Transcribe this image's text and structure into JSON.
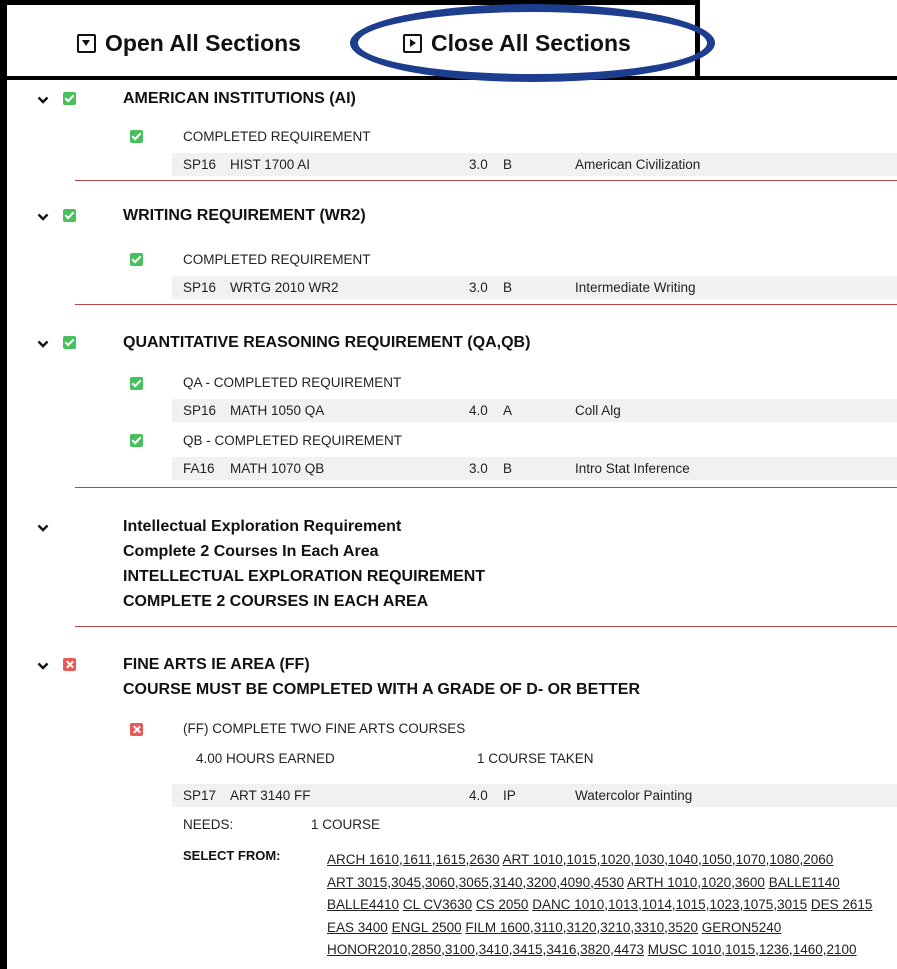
{
  "toolbar": {
    "open_label": "Open All Sections",
    "close_label": "Close All Sections",
    "highlight_color": "#1d3d8f"
  },
  "sections": [
    {
      "title": "AMERICAN INSTITUTIONS (AI)",
      "status": "complete",
      "requirements": [
        {
          "label": "COMPLETED REQUIREMENT",
          "courses": [
            {
              "term": "SP16",
              "course": "HIST 1700 AI",
              "credits": "3.0",
              "grade": "B",
              "title": "American Civilization"
            }
          ]
        }
      ]
    },
    {
      "title": "WRITING REQUIREMENT (WR2)",
      "status": "complete",
      "requirements": [
        {
          "label": "COMPLETED REQUIREMENT",
          "courses": [
            {
              "term": "SP16",
              "course": "WRTG 2010 WR2",
              "credits": "3.0",
              "grade": "B",
              "title": "Intermediate Writing"
            }
          ]
        }
      ]
    },
    {
      "title": "QUANTITATIVE REASONING REQUIREMENT (QA,QB)",
      "status": "complete",
      "requirements": [
        {
          "label": "QA - COMPLETED REQUIREMENT",
          "courses": [
            {
              "term": "SP16",
              "course": "MATH 1050 QA",
              "credits": "4.0",
              "grade": "A",
              "title": "Coll Alg"
            }
          ]
        },
        {
          "label": "QB - COMPLETED REQUIREMENT",
          "courses": [
            {
              "term": "FA16",
              "course": "MATH 1070 QB",
              "credits": "3.0",
              "grade": "B",
              "title": "Intro Stat Inference"
            }
          ]
        }
      ]
    },
    {
      "title_lines": [
        "Intellectual Exploration Requirement",
        "Complete 2 Courses In Each Area",
        "INTELLECTUAL EXPLORATION REQUIREMENT",
        "COMPLETE 2 COURSES IN EACH AREA"
      ]
    },
    {
      "title_lines": [
        "FINE ARTS IE AREA (FF)",
        "COURSE MUST BE COMPLETED WITH A GRADE OF D- OR BETTER"
      ],
      "status": "incomplete",
      "requirements": [
        {
          "label": "(FF) COMPLETE TWO FINE ARTS COURSES",
          "hours_earned": "4.00 HOURS EARNED",
          "courses_taken": "1 COURSE TAKEN",
          "courses": [
            {
              "term": "SP17",
              "course": "ART 3140 FF",
              "credits": "4.0",
              "grade": "IP",
              "title": "Watercolor Painting"
            }
          ],
          "needs_label": "NEEDS:",
          "needs_value": "1 COURSE",
          "select_from_label": "SELECT FROM:",
          "select_from": [
            "ARCH 1610",
            "1611",
            "1615",
            "2630",
            "ART 1010",
            "1015",
            "1020",
            "1030",
            "1040",
            "1050",
            "1070",
            "1080",
            "2060",
            "ART 3015",
            "3045",
            "3060",
            "3065",
            "3140",
            "3200",
            "4090",
            "4530",
            "ARTH 1010",
            "1020",
            "3600",
            "BALLE1140",
            "BALLE4410",
            "CL CV3630",
            "CS 2050",
            "DANC 1010",
            "1013",
            "1014",
            "1015",
            "1023",
            "1075",
            "3015",
            "DES 2615",
            "EAS 3400",
            "ENGL 2500",
            "FILM 1600",
            "3110",
            "3120",
            "3210",
            "3310",
            "3520",
            "GERON5240",
            "HONOR2010",
            "2850",
            "3100",
            "3410",
            "3415",
            "3416",
            "3820",
            "4473",
            "MUSC 1010",
            "1015",
            "1236",
            "1460",
            "2100"
          ]
        }
      ]
    }
  ]
}
